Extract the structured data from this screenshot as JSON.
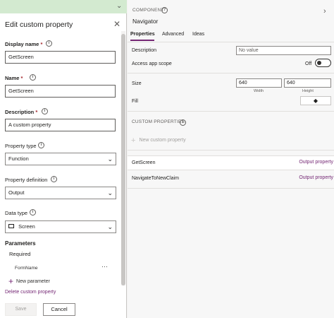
{
  "dialog": {
    "title": "Edit custom property",
    "fields": {
      "display_name": {
        "label": "Display name",
        "required_mark": "*",
        "value": "GetScreen"
      },
      "name": {
        "label": "Name",
        "required_mark": "*",
        "value": "GetScreen"
      },
      "description": {
        "label": "Description",
        "required_mark": "*",
        "value": "A custom property"
      },
      "property_type": {
        "label": "Property type",
        "value": "Function"
      },
      "property_definition": {
        "label": "Property definition",
        "value": "Output"
      },
      "data_type": {
        "label": "Data type",
        "value": "Screen"
      }
    },
    "parameters": {
      "title": "Parameters",
      "required_label": "Required",
      "items": [
        "FormName"
      ],
      "more_label": "···",
      "new_label": "New parameter"
    },
    "delete_label": "Delete custom property",
    "save_label": "Save",
    "cancel_label": "Cancel",
    "accent_color": "#742774"
  },
  "component": {
    "section_label": "COMPONENT",
    "name": "Navigator",
    "tabs": [
      "Properties",
      "Advanced",
      "Ideas"
    ],
    "active_tab": "Properties",
    "description": {
      "label": "Description",
      "placeholder": "No value"
    },
    "access_scope": {
      "label": "Access app scope",
      "state": "Off"
    },
    "size": {
      "label": "Size",
      "width": "640",
      "height": "640",
      "width_label": "Width",
      "height_label": "Height"
    },
    "fill": {
      "label": "Fill",
      "icon": "paint-bucket-icon"
    },
    "custom_properties": {
      "title": "CUSTOM PROPERTIES",
      "new_label": "New custom property",
      "items": [
        {
          "name": "GetScreen",
          "type": "Output property"
        },
        {
          "name": "NavigateToNewClaim",
          "type": "Output property"
        }
      ]
    }
  }
}
